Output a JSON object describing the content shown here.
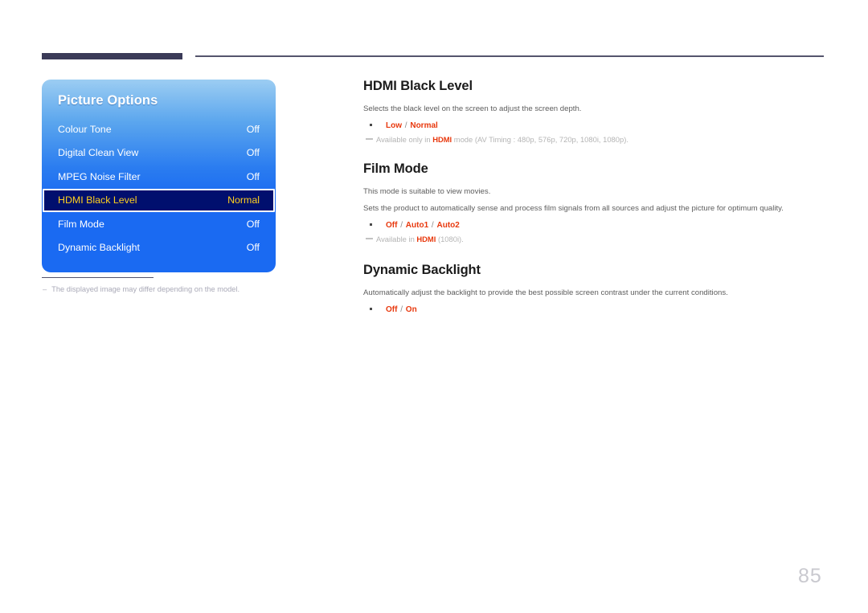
{
  "page": {
    "number": "85",
    "accent_red": "#e8380d",
    "osd_blue": "#1a6af2",
    "osd_selected_bg": "#000f6e",
    "osd_selected_text": "#ffd01e",
    "header_rule_color": "#3b3b58"
  },
  "osd": {
    "title": "Picture Options",
    "rows": [
      {
        "label": "Colour Tone",
        "value": "Off",
        "selected": false
      },
      {
        "label": "Digital Clean View",
        "value": "Off",
        "selected": false
      },
      {
        "label": "MPEG Noise Filter",
        "value": "Off",
        "selected": false
      },
      {
        "label": "HDMI Black Level",
        "value": "Normal",
        "selected": true
      },
      {
        "label": "Film Mode",
        "value": "Off",
        "selected": false
      },
      {
        "label": "Dynamic Backlight",
        "value": "Off",
        "selected": false
      }
    ]
  },
  "left_footnote": {
    "dash": "–",
    "text": "The displayed image may differ depending on the model."
  },
  "sections": [
    {
      "title": "HDMI Black Level",
      "descriptions": [
        "Selects the black level on the screen to adjust the screen depth."
      ],
      "options": [
        {
          "name": "Low",
          "bold": true
        },
        {
          "name": " / ",
          "bold": false
        },
        {
          "name": "Normal",
          "bold": true
        }
      ],
      "options_text": "Low / Normal",
      "note": {
        "prefix": "Available only in ",
        "highlight": "HDMI",
        "suffix": " mode (AV Timing : 480p, 576p, 720p, 1080i, 1080p)."
      }
    },
    {
      "title": "Film Mode",
      "descriptions": [
        "This mode is suitable to view movies.",
        "Sets the product to automatically sense and process film signals from all sources and adjust the picture for optimum quality."
      ],
      "options_text": "Off / Auto1 / Auto2",
      "note": {
        "prefix": "Available in ",
        "highlight": "HDMI",
        "suffix": " (1080i)."
      }
    },
    {
      "title": "Dynamic Backlight",
      "descriptions": [
        "Automatically adjust the backlight to provide the best possible screen contrast under the current conditions."
      ],
      "options_text": "Off / On",
      "note": null
    }
  ]
}
